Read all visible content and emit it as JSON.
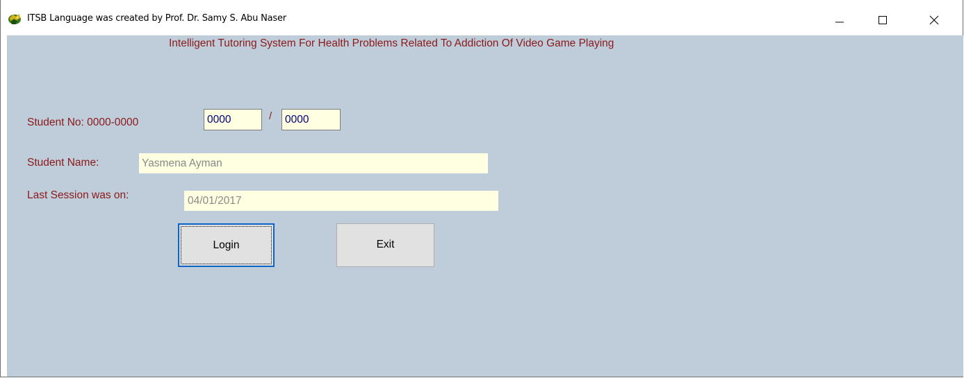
{
  "window": {
    "title": "ITSB Language was created by Prof. Dr. Samy S. Abu Naser",
    "controls": {
      "minimize_icon": "minimize-icon",
      "maximize_icon": "maximize-icon",
      "close_icon": "close-icon"
    }
  },
  "form": {
    "heading": "Intelligent Tutoring System For Health Problems Related To Addiction Of Video Game Playing",
    "student_no": {
      "label": "Student No: 0000-0000",
      "part1": "0000",
      "separator": "/",
      "part2": "0000"
    },
    "student_name": {
      "label": "Student Name:",
      "value": "Yasmena Ayman"
    },
    "last_session": {
      "label": "Last Session was on:",
      "value": "04/01/2017"
    },
    "buttons": {
      "login": "Login",
      "exit": "Exit"
    }
  },
  "colors": {
    "client_background": "#bfccd9",
    "label_text": "#8b1a1a",
    "textbox_background": "#ffffe1",
    "focus_border": "#0a64c8"
  }
}
